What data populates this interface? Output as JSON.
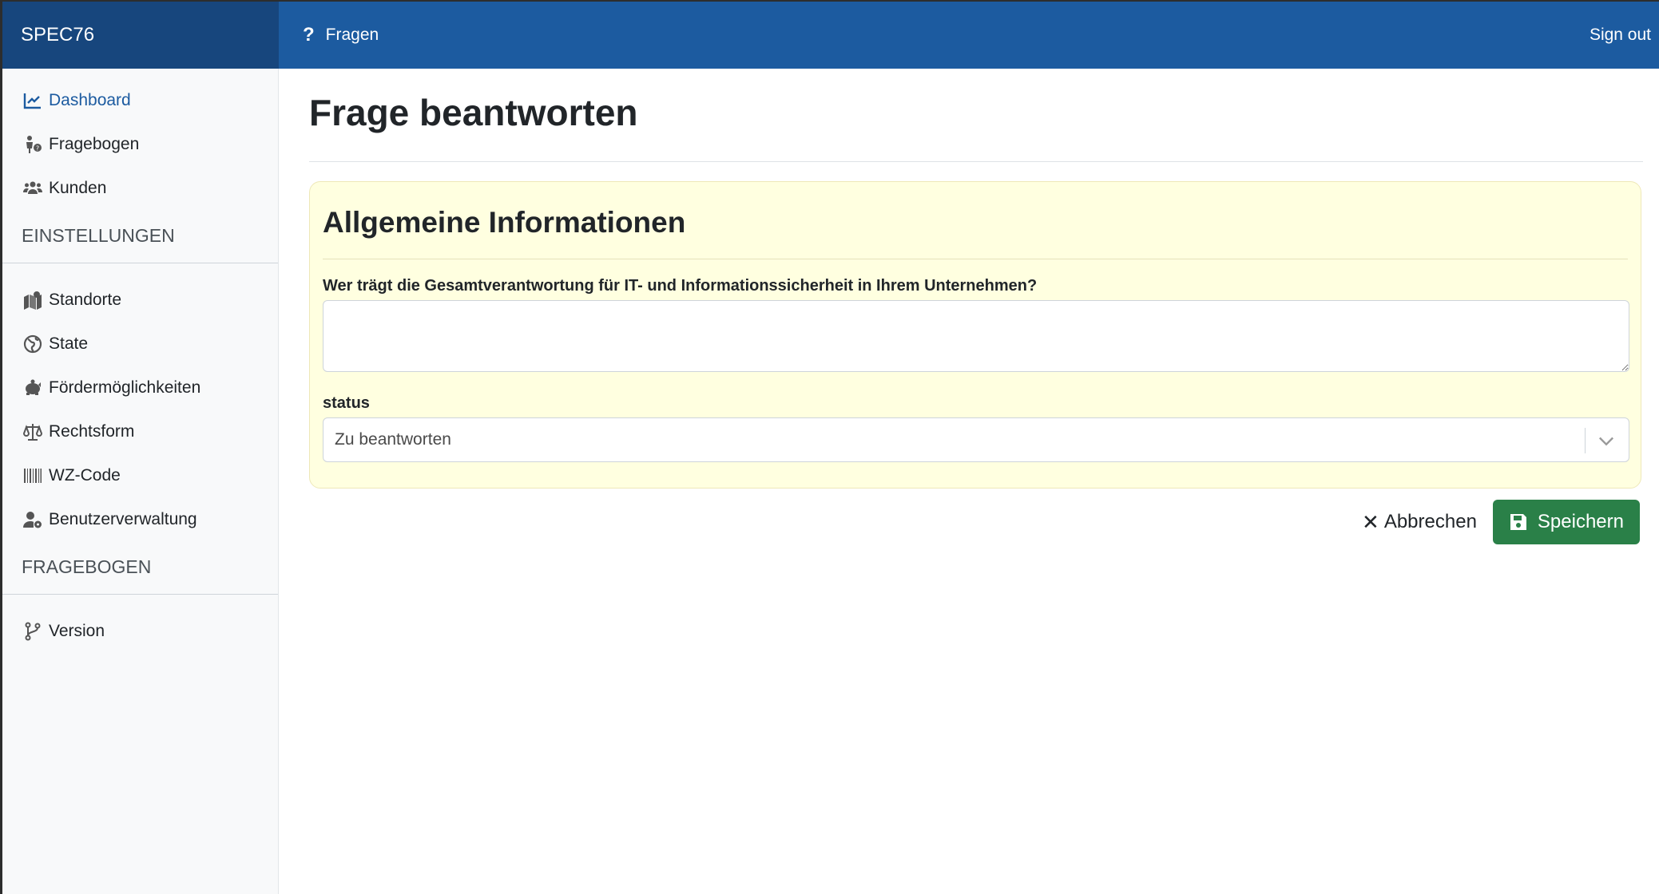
{
  "topbar": {
    "brand": "SPEC76",
    "nav_link": "Fragen",
    "signout": "Sign out"
  },
  "sidebar": {
    "main_items": [
      {
        "label": "Dashboard",
        "icon": "chart-line-icon",
        "active": true
      },
      {
        "label": "Fragebogen",
        "icon": "person-question-icon"
      },
      {
        "label": "Kunden",
        "icon": "users-icon"
      }
    ],
    "heading_settings": "EINSTELLUNGEN",
    "settings_items": [
      {
        "label": "Standorte",
        "icon": "map-location-icon"
      },
      {
        "label": "State",
        "icon": "globe-icon"
      },
      {
        "label": "Fördermöglichkeiten",
        "icon": "piggy-bank-icon"
      },
      {
        "label": "Rechtsform",
        "icon": "scale-balanced-icon"
      },
      {
        "label": "WZ-Code",
        "icon": "barcode-icon"
      },
      {
        "label": "Benutzerverwaltung",
        "icon": "user-gear-icon"
      }
    ],
    "heading_fragebogen": "FRAGEBOGEN",
    "fragebogen_items": [
      {
        "label": "Version",
        "icon": "code-branch-icon"
      }
    ]
  },
  "main": {
    "title": "Frage beantworten",
    "card": {
      "title": "Allgemeine Informationen",
      "question": "Wer trägt die Gesamtverantwortung für IT- und Informationssicherheit in Ihrem Unternehmen?",
      "answer_value": "",
      "status_label": "status",
      "status_value": "Zu beantworten"
    },
    "cancel_label": "Abbrechen",
    "save_label": "Speichern"
  },
  "colors": {
    "topbar": "#1c5ba0",
    "brand_bg": "#17467d",
    "card_bg": "#ffffe0",
    "save_button": "#2a8048",
    "active_link": "#1c5ba0"
  }
}
